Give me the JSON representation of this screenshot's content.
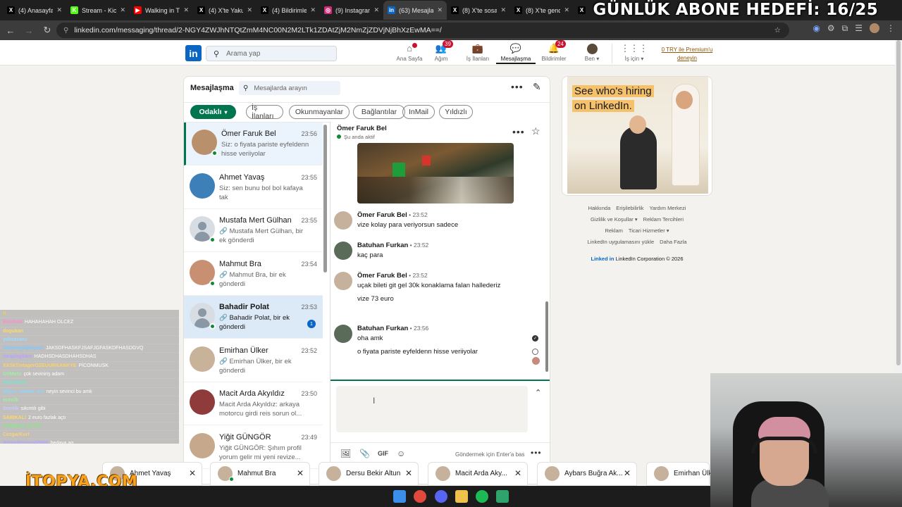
{
  "browser": {
    "tabs": [
      {
        "label": "(4) Anasayfa",
        "fav": "X",
        "color": "#000000"
      },
      {
        "label": "Stream - Kick",
        "fav": "K",
        "color": "#53fc18"
      },
      {
        "label": "Walking in T",
        "fav": "▶",
        "color": "#ff0000"
      },
      {
        "label": "(4) X'te Yaku",
        "fav": "X",
        "color": "#000000"
      },
      {
        "label": "(4) Bildirimle",
        "fav": "X",
        "color": "#000000"
      },
      {
        "label": "(9) Instagram",
        "fav": "◎",
        "color": "#d62976"
      },
      {
        "label": "(63) Mesajla",
        "fav": "in",
        "color": "#0a66c2"
      },
      {
        "label": "(8) X'te sosa",
        "fav": "X",
        "color": "#000000"
      },
      {
        "label": "(8) X'te genc",
        "fav": "X",
        "color": "#000000"
      },
      {
        "label": "",
        "fav": "X",
        "color": "#000000"
      }
    ],
    "url": "linkedin.com/messaging/thread/2-NGY4ZWJhNTQtZmM4NC00N2M2LTk1ZDAtZjM2NmZjZDVjNjBhXzEwMA==/"
  },
  "overlay": {
    "goal": "GÜNLÜK ABONE HEDEFİ: 16/25",
    "sponsor": "İTOPYA.COM"
  },
  "nav": {
    "search_placeholder": "Arama yap",
    "items": [
      {
        "label": "Ana Sayfa",
        "icon": "home-icon",
        "glyph": "⌂",
        "badge": ""
      },
      {
        "label": "Ağım",
        "icon": "network-icon",
        "glyph": "👥",
        "badge": "39"
      },
      {
        "label": "İş İlanları",
        "icon": "jobs-icon",
        "glyph": "💼",
        "badge": ""
      },
      {
        "label": "Mesajlaşma",
        "icon": "messaging-icon",
        "glyph": "💬",
        "badge": ""
      },
      {
        "label": "Bildirimler",
        "icon": "bell-icon",
        "glyph": "🔔",
        "badge": "24"
      },
      {
        "label": "Ben ▾",
        "icon": "me-avatar",
        "glyph": "●",
        "badge": ""
      },
      {
        "label": "İş için ▾",
        "icon": "grid-icon",
        "glyph": "⋮⋮⋮",
        "badge": ""
      }
    ],
    "premium": "0 TRY ile Premium'u deneyin"
  },
  "messaging": {
    "title": "Mesajlaşma",
    "search_placeholder": "Mesajlarda arayın",
    "filters": [
      "Odaklı",
      "İş İlanları",
      "Okunmayanlar",
      "Bağlantılar",
      "InMail",
      "Yıldızlı"
    ],
    "conversations": [
      {
        "name": "Ömer Faruk Bel",
        "time": "23:56",
        "preview": "Siz: o fiyata pariste eyfeldenn hisse veriiyolar",
        "online": true,
        "unread": ""
      },
      {
        "name": "Ahmet Yavaş",
        "time": "23:55",
        "preview": "Siz: sen bunu bol  bol kafaya tak",
        "online": false,
        "unread": ""
      },
      {
        "name": "Mustafa Mert Gülhan",
        "time": "23:55",
        "preview": "🔗 Mustafa Mert Gülhan, bir ek gönderdi",
        "online": true,
        "unread": ""
      },
      {
        "name": "Mahmut Bra",
        "time": "23:54",
        "preview": "🔗 Mahmut Bra, bir ek gönderdi",
        "online": true,
        "unread": ""
      },
      {
        "name": "Bahadir Polat",
        "time": "23:53",
        "preview": "🔗 Bahadir Polat, bir ek gönderdi",
        "online": true,
        "unread": "1"
      },
      {
        "name": "Emirhan Ülker",
        "time": "23:52",
        "preview": "🔗 Emirhan Ülker, bir ek gönderdi",
        "online": false,
        "unread": ""
      },
      {
        "name": "Macit Arda Akyıldız",
        "time": "23:50",
        "preview": "Macit Arda Akyıldız: arkaya motorcu girdi reis sorun ol...",
        "online": false,
        "unread": ""
      },
      {
        "name": "Yiğit GÜNGÖR",
        "time": "23:49",
        "preview": "Yiğit GÜNGÖR: Şıhım profil yorum gelir mi yeni revize...",
        "online": false,
        "unread": ""
      }
    ],
    "thread": {
      "name": "Ömer Faruk Bel",
      "status": "Şu anda aktif",
      "messages": [
        {
          "sender": "Ömer Faruk Bel",
          "time": "23:52",
          "lines": [
            "vize kolay para veriyorsun sadece"
          ]
        },
        {
          "sender": "Batuhan Furkan",
          "time": "23:52",
          "lines": [
            "kaç para"
          ]
        },
        {
          "sender": "Ömer Faruk Bel",
          "time": "23:52",
          "lines": [
            "uçak bileti git gel 30k konaklama falan hallederiz",
            "vize 73 euro"
          ]
        },
        {
          "sender": "Batuhan Furkan",
          "time": "23:56",
          "lines": [
            "oha amk",
            "o fiyata pariste eyfeldenn hisse veriiyolar"
          ]
        }
      ],
      "send_hint": "Göndermek için Enter'a bas",
      "gif_label": "GIF"
    }
  },
  "ad": {
    "line1": "See who's hiring",
    "line2": "on LinkedIn."
  },
  "footer": {
    "row1": [
      "Hakkında",
      "Erişilebilirlik",
      "Yardım Merkezi"
    ],
    "row2": [
      "Gizlilik ve Koşullar ▾",
      "Reklam Tercihleri"
    ],
    "row3": [
      "Reklam",
      "Ticari Hizmetler ▾"
    ],
    "row4": [
      "LinkedIn uygulamasını yükle",
      "Daha Fazla"
    ],
    "brand_logo": "Linked in",
    "brand_text": "LinkedIn Corporation © 2026"
  },
  "popups": [
    "Ahmet Yavaş",
    "Mahmut Bra",
    "Dersu Bekir Altun",
    "Macit Arda Aky...",
    "Aybars Buğra Ak...",
    "Emirhan Ülk"
  ],
  "stream_chat": [
    {
      "user": "!! _ ",
      "msg": "",
      "color": "#f7d04a"
    },
    {
      "user": "Emirhan",
      "msg": "HAHAHAHAH OLCEZ",
      "color": "#ff8bd1"
    },
    {
      "user": "dogukan",
      "msg": "",
      "color": "#ffd86b"
    },
    {
      "user": "yalnizsaru",
      "msg": "",
      "color": "#9bdcff"
    },
    {
      "user": "Sabahagiljakgaur",
      "msg": "JAKSDFHASKFJSAFJGFASKDFHASDGVQ",
      "color": "#7ec9ff"
    },
    {
      "user": "itiraplagkarc",
      "msg": "HADHSDHASDHAHSDHAS",
      "color": "#b8a2ff"
    },
    {
      "user": "XXSkTintagerOZEUURKANKYE",
      "msg": "PİCONMUSK",
      "color": "#ffd166"
    },
    {
      "user": "UrlMoto",
      "msg": "çok seviniriş adam",
      "color": "#9ef0a3"
    },
    {
      "user": "WoletRate",
      "msg": "",
      "color": "#7ee0d0"
    },
    {
      "user": "Mtrpu_arbom_ezr",
      "msg": "neyin sevinci bu amk",
      "color": "#8fd4ff"
    },
    {
      "user": "ecerilk",
      "msg": "",
      "color": "#9ef09e"
    },
    {
      "user": "Semilk",
      "msg": "sıkıntılı gibi",
      "color": "#c9c9ff"
    },
    {
      "user": "SABIKALI",
      "msg": "2 euro fazlak açtı",
      "color": "#ffd86b"
    },
    {
      "user": "Yrtmaser_U7777",
      "msg": "",
      "color": "#7ef07e"
    },
    {
      "user": "CezgarKurt",
      "msg": "",
      "color": "#ffcf7a"
    },
    {
      "user": "Ahmedovirgo00000",
      "msg": "bedava aq",
      "color": "#b8a2ff"
    }
  ]
}
